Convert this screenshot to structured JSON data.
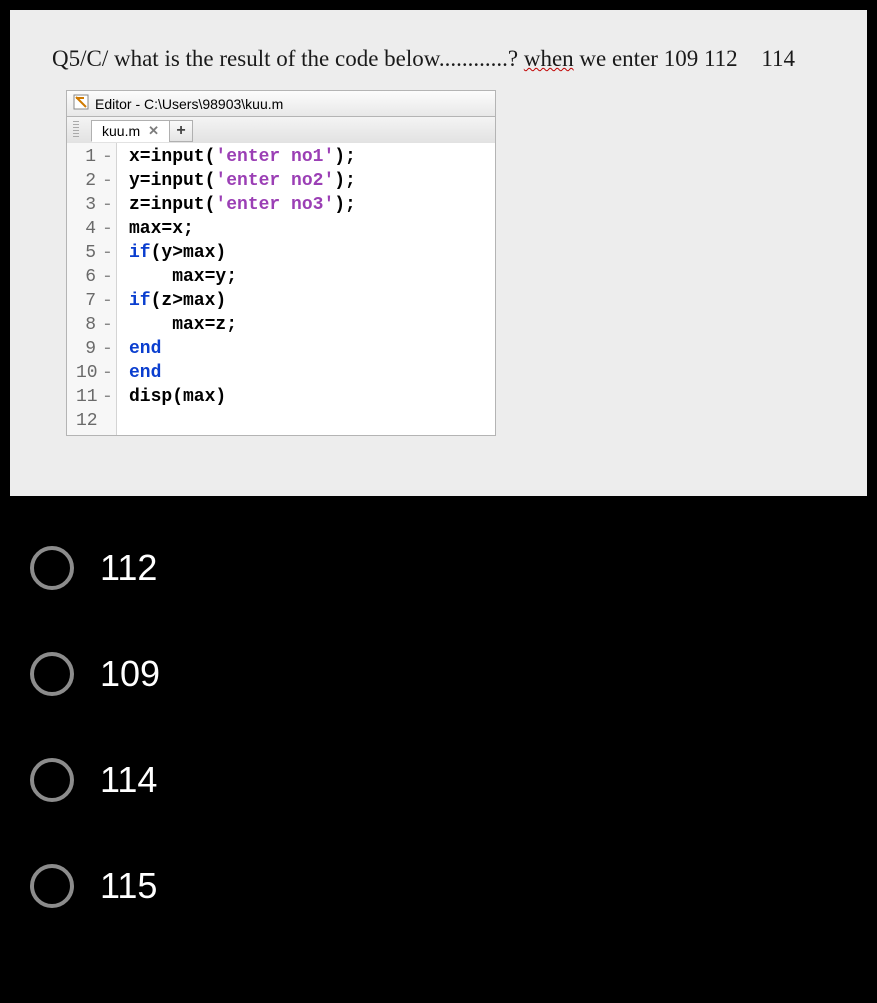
{
  "question": {
    "prefix": "Q5/C/ what is the result of the code below............? ",
    "when_word": "when",
    "suffix": " we enter 109  112",
    "extra_input": "114"
  },
  "editor": {
    "title": "Editor - C:\\Users\\98903\\kuu.m",
    "tab_name": "kuu.m",
    "close_glyph": "✕",
    "plus_glyph": "+"
  },
  "code": {
    "lines": [
      {
        "n": "1",
        "dash": "-",
        "pre": "x=input(",
        "str": "'enter no1'",
        "post": ");"
      },
      {
        "n": "2",
        "dash": "-",
        "pre": "y=input(",
        "str": "'enter no2'",
        "post": ");"
      },
      {
        "n": "3",
        "dash": "-",
        "pre": "z=input(",
        "str": "'enter no3'",
        "post": ");"
      },
      {
        "n": "4",
        "dash": "-",
        "pre": "max=x;",
        "str": "",
        "post": ""
      },
      {
        "n": "5",
        "dash": "-",
        "kw": "if",
        "pre": "(y>max)",
        "str": "",
        "post": ""
      },
      {
        "n": "6",
        "dash": "-",
        "pre": "    max=y;",
        "str": "",
        "post": ""
      },
      {
        "n": "7",
        "dash": "-",
        "kw": "if",
        "pre": "(z>max)",
        "str": "",
        "post": ""
      },
      {
        "n": "8",
        "dash": "-",
        "pre": "    max=z;",
        "str": "",
        "post": ""
      },
      {
        "n": "9",
        "dash": "-",
        "kw": "end",
        "pre": "",
        "str": "",
        "post": ""
      },
      {
        "n": "10",
        "dash": "-",
        "kw": "end",
        "pre": "",
        "str": "",
        "post": ""
      },
      {
        "n": "11",
        "dash": "-",
        "pre": "disp(max)",
        "str": "",
        "post": ""
      },
      {
        "n": "12",
        "dash": "",
        "pre": "",
        "str": "",
        "post": ""
      }
    ]
  },
  "options": [
    {
      "label": "112"
    },
    {
      "label": "109"
    },
    {
      "label": "114"
    },
    {
      "label": "115"
    }
  ]
}
